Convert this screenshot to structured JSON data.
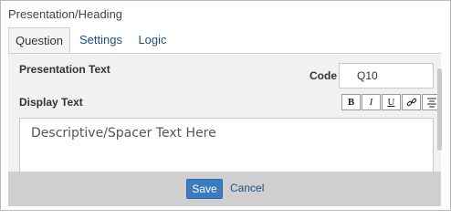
{
  "dialog": {
    "title": "Presentation/Heading"
  },
  "tabs": [
    {
      "label": "Question",
      "active": true
    },
    {
      "label": "Settings",
      "active": false
    },
    {
      "label": "Logic",
      "active": false
    }
  ],
  "form": {
    "presentation_text_label": "Presentation Text",
    "code_label": "Code",
    "code_value": "Q10",
    "display_text_label": "Display Text",
    "editor_text": "Descriptive/Spacer Text Here"
  },
  "toolbar": {
    "bold": "B",
    "italic": "I",
    "underline": "U"
  },
  "footer": {
    "save_label": "Save",
    "cancel_label": "Cancel"
  },
  "colors": {
    "accent": "#3a7bbf",
    "link": "#1f4f82",
    "panel_bg": "#f1f1f1",
    "footer_bg": "#cfcfcf"
  }
}
